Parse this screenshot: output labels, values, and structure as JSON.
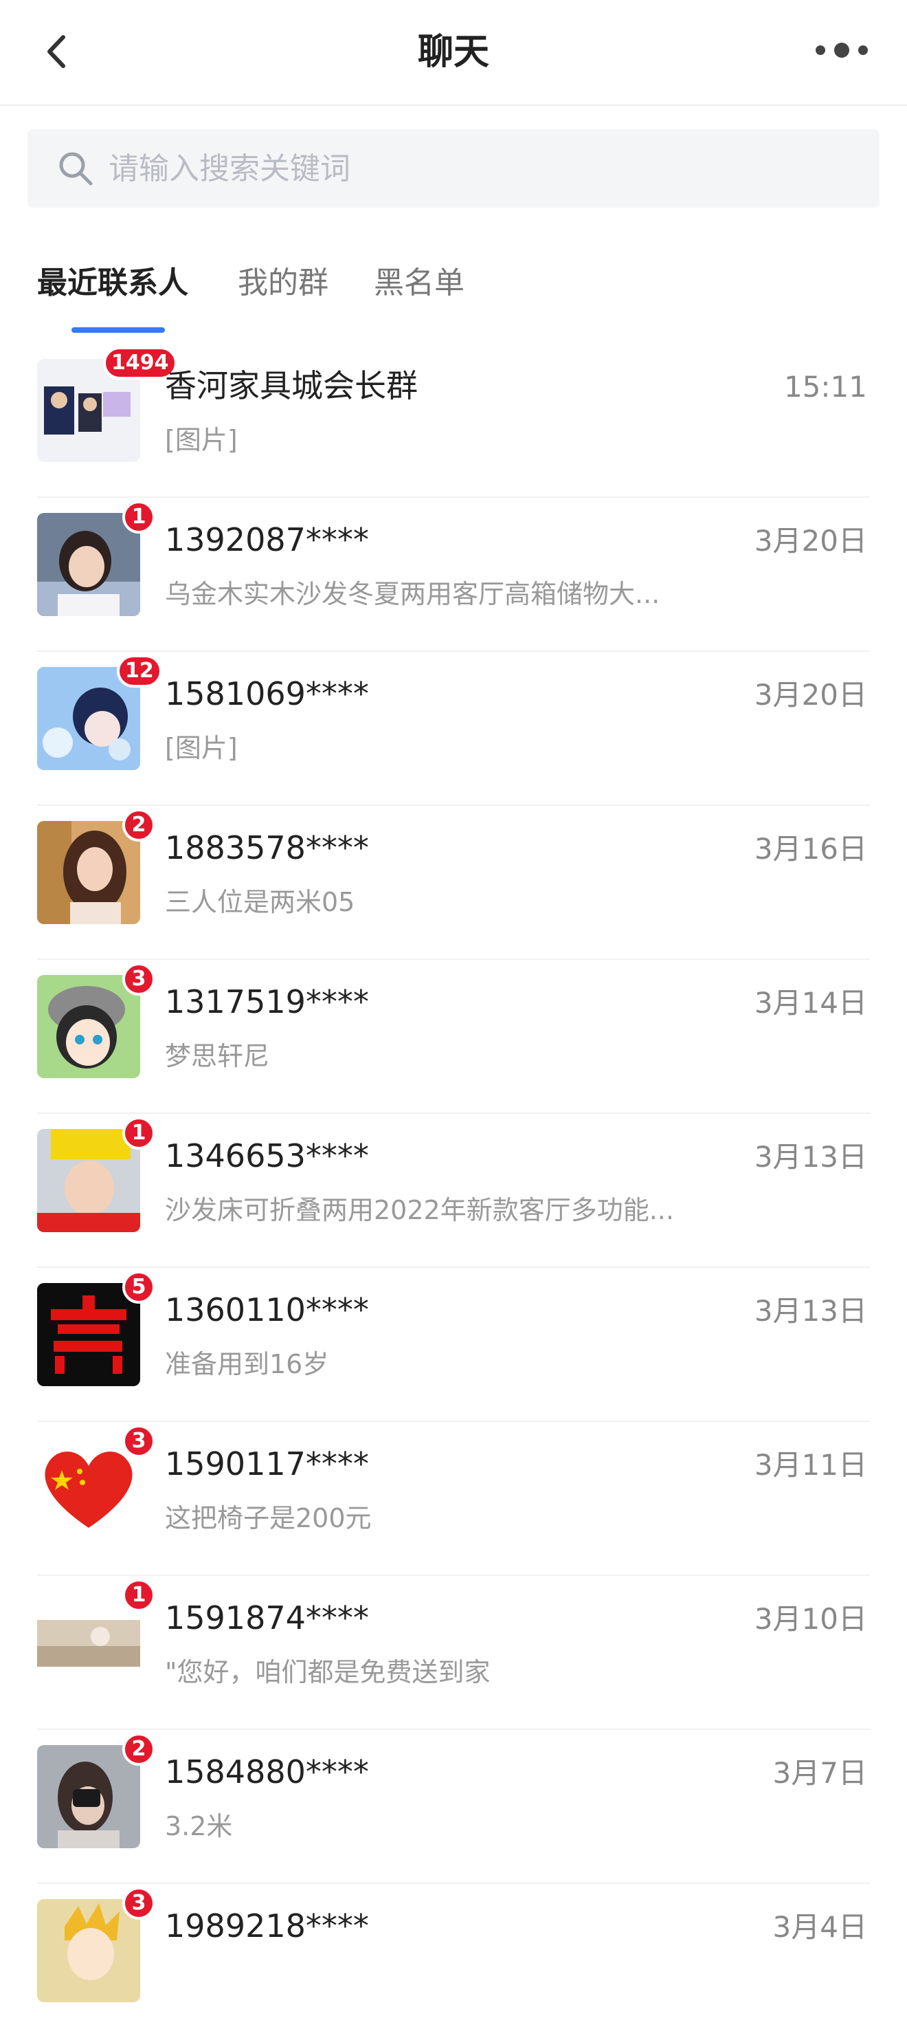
{
  "header": {
    "title": "聊天",
    "back_icon": "chevron-left-icon",
    "more_icon": "more-dots-icon"
  },
  "search": {
    "placeholder": "请输入搜索关键词",
    "icon": "search-icon"
  },
  "tabs": [
    {
      "label": "最近联系人",
      "active": true
    },
    {
      "label": "我的群",
      "active": false
    },
    {
      "label": "黑名单",
      "active": false
    }
  ],
  "colors": {
    "accent": "#2f7cf6",
    "badge": "#e3182d"
  },
  "conversations": [
    {
      "name": "香河家具城会长群",
      "time": "15:11",
      "preview": "[图片]",
      "unread": "1494"
    },
    {
      "name": "1392087****",
      "time": "3月20日",
      "preview": "乌金木实木沙发冬夏两用客厅高箱储物大...",
      "unread": "1"
    },
    {
      "name": "1581069****",
      "time": "3月20日",
      "preview": "[图片]",
      "unread": "12"
    },
    {
      "name": "1883578****",
      "time": "3月16日",
      "preview": "三人位是两米05",
      "unread": "2"
    },
    {
      "name": "1317519****",
      "time": "3月14日",
      "preview": "梦思轩尼",
      "unread": "3"
    },
    {
      "name": "1346653****",
      "time": "3月13日",
      "preview": "沙发床可折叠两用2022年新款客厅多功能...",
      "unread": "1"
    },
    {
      "name": "1360110****",
      "time": "3月13日",
      "preview": "准备用到16岁",
      "unread": "5"
    },
    {
      "name": "1590117****",
      "time": "3月11日",
      "preview": "这把椅子是200元",
      "unread": "3"
    },
    {
      "name": "1591874****",
      "time": "3月10日",
      "preview": "\"您好，咱们都是免费送到家",
      "unread": "1"
    },
    {
      "name": "1584880****",
      "time": "3月7日",
      "preview": "3.2米",
      "unread": "2"
    },
    {
      "name": "1989218****",
      "time": "3月4日",
      "preview": "",
      "unread": "3"
    }
  ]
}
